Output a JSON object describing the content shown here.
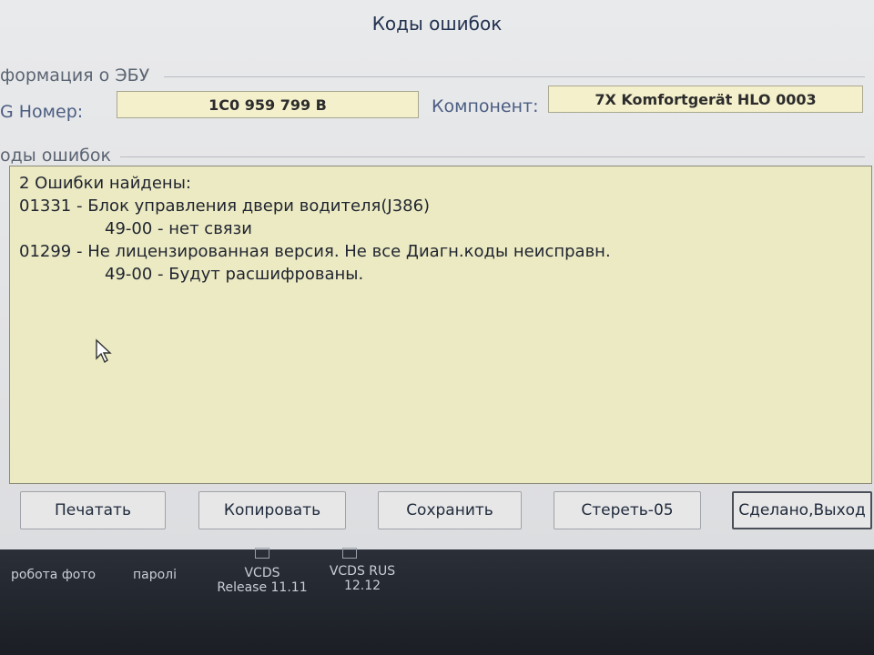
{
  "window": {
    "title": "Коды ошибок"
  },
  "ecu_info": {
    "group_label": "формация о ЭБУ",
    "part_number_label": "G Номер:",
    "part_number_value": "1C0 959 799 B",
    "component_label": "Компонент:",
    "component_value": "7X Komfortgerät HLO 0003"
  },
  "fault_codes": {
    "group_label": "оды ошибок",
    "lines": [
      "2 Ошибки найдены:",
      "01331 - Блок управления двери водителя(J386)",
      "49-00 - нет связи",
      "01299 - Не лицензированная версия. Не все Диагн.коды неисправн.",
      "49-00 - Будут расшифрованы."
    ]
  },
  "buttons": {
    "print": "Печатать",
    "copy": "Копировать",
    "save": "Сохранить",
    "clear": "Стереть-05",
    "done": "Сделано,Выход"
  },
  "taskbar": {
    "items": [
      {
        "label": "робота фото"
      },
      {
        "label": "паролі"
      },
      {
        "label": "VCDS",
        "sub": "Release 11.11"
      },
      {
        "label": "VCDS RUS",
        "sub": "12.12"
      }
    ]
  }
}
